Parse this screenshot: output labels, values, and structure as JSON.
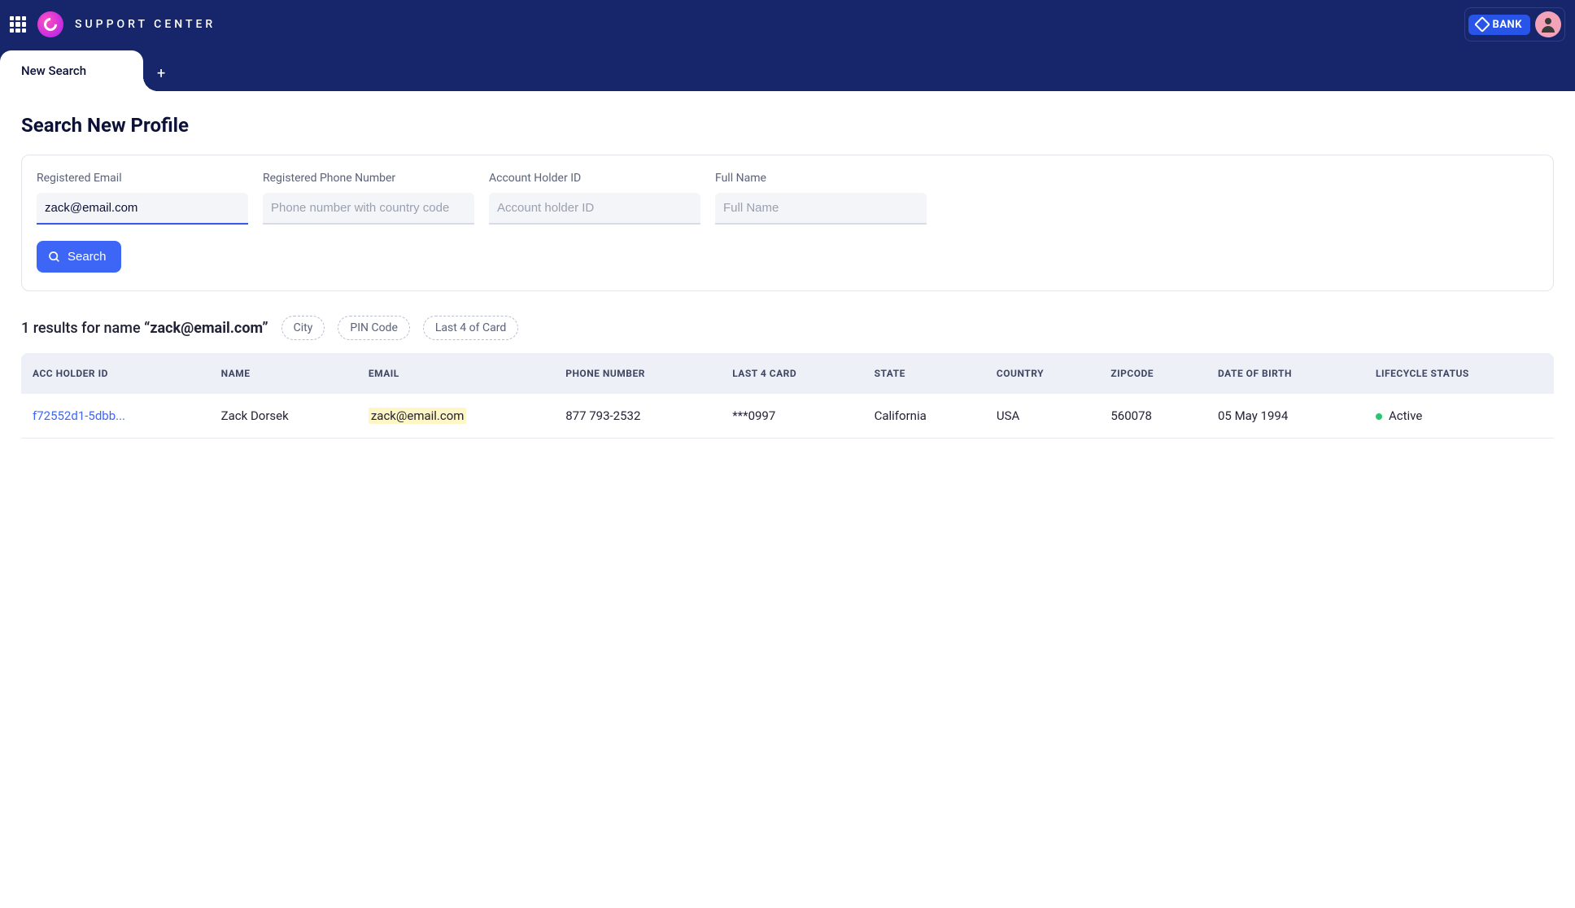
{
  "header": {
    "brand": "SUPPORT CENTER",
    "bank_label": "BANK"
  },
  "tabs": {
    "active": "New Search"
  },
  "page": {
    "title": "Search New Profile"
  },
  "searchForm": {
    "fields": {
      "email": {
        "label": "Registered Email",
        "value": "zack@email.com",
        "placeholder": ""
      },
      "phone": {
        "label": "Registered Phone Number",
        "value": "",
        "placeholder": "Phone number with country code"
      },
      "accountId": {
        "label": "Account Holder ID",
        "value": "",
        "placeholder": "Account holder ID"
      },
      "fullName": {
        "label": "Full Name",
        "value": "",
        "placeholder": "Full Name"
      }
    },
    "submit": "Search"
  },
  "results": {
    "count_prefix": "1 results for name ",
    "query": "“zack@email.com”",
    "filters": [
      "City",
      "PIN Code",
      "Last 4 of Card"
    ],
    "columns": [
      "ACC HOLDER ID",
      "NAME",
      "EMAIL",
      "PHONE NUMBER",
      "LAST 4 CARD",
      "STATE",
      "COUNTRY",
      "ZIPCODE",
      "DATE OF BIRTH",
      "LIFECYCLE STATUS"
    ],
    "rows": [
      {
        "acc_holder_id": "f72552d1-5dbb...",
        "name": "Zack Dorsek",
        "email": "zack@email.com",
        "phone": "877 793-2532",
        "last4": "***0997",
        "state": "California",
        "country": "USA",
        "zipcode": "560078",
        "dob": "05 May 1994",
        "status": "Active"
      }
    ]
  }
}
